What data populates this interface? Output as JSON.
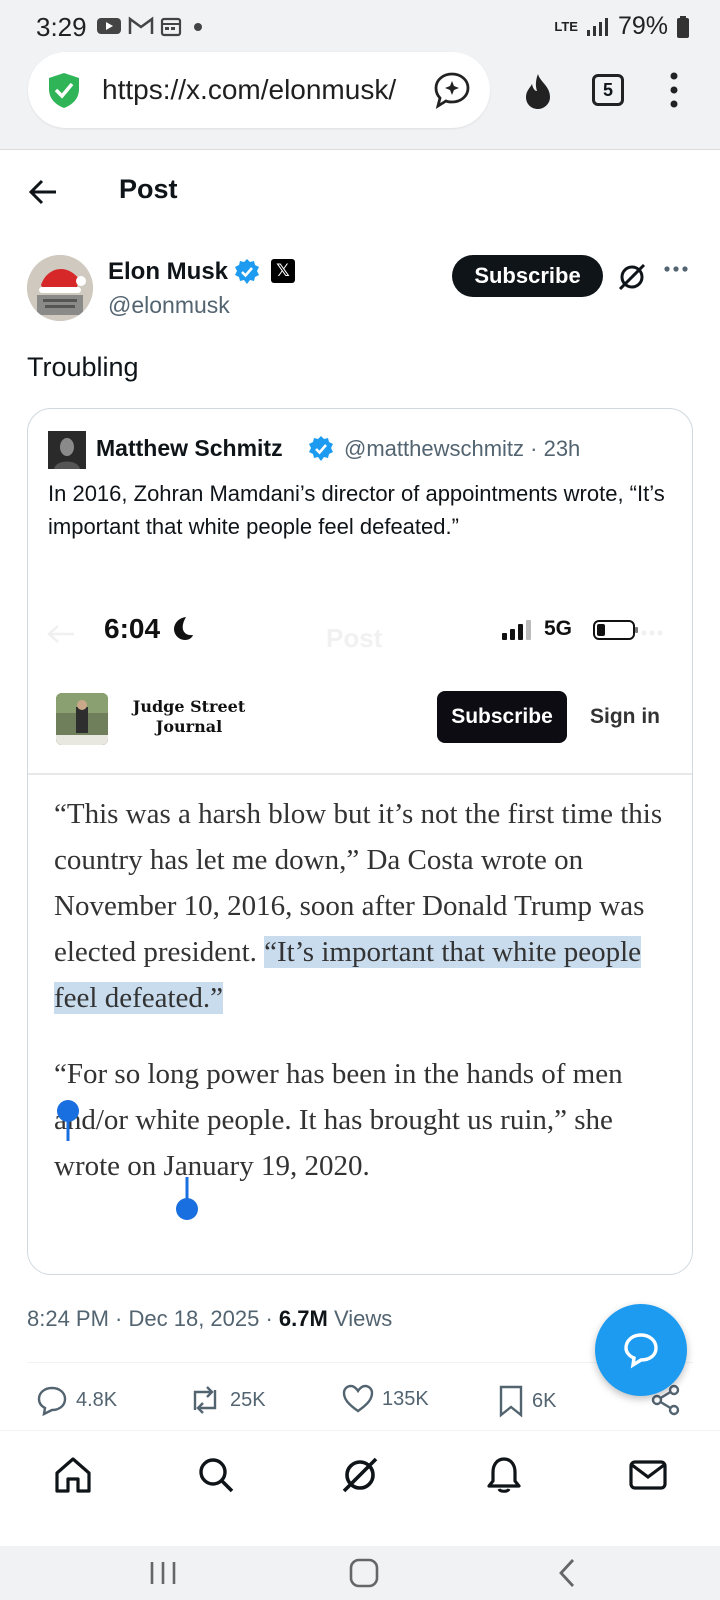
{
  "status_bar": {
    "time": "3:29",
    "network": "LTE",
    "battery": "79%"
  },
  "browser": {
    "url": "https://x.com/elonmusk/",
    "tab_count": "5"
  },
  "header": {
    "title": "Post"
  },
  "author": {
    "name": "Elon Musk",
    "handle": "@elonmusk",
    "x_badge": "𝕏",
    "subscribe_label": "Subscribe"
  },
  "post": {
    "text": "Troubling"
  },
  "quoted": {
    "name": "Matthew Schmitz",
    "handle_time": "@matthewschmitz · 23h",
    "text": "In 2016, Zohran Mamdani’s director of appointments wrote, “It’s important that white people feel defeated.”"
  },
  "screenshot": {
    "time": "6:04",
    "ghost_title": "Post",
    "network": "5G",
    "publication": "Judge Street Journal",
    "subscribe_label": "Subscribe",
    "signin_label": "Sign in",
    "paragraph1_plain": "“This was a harsh blow but it’s not the first time this country has let me down,” Da Costa wrote on November 10, 2016, soon after Donald Trump was elected president. ",
    "paragraph1_highlight": "“It’s important that white people feel defeated.”",
    "paragraph2": "“For so long power has been in the hands of men and/or white people. It has brought us ruin,” she wrote on January 19, 2020."
  },
  "meta": {
    "time_date": "8:24 PM · Dec 18, 2025 · ",
    "views_count": "6.7M",
    "views_label": " Views"
  },
  "actions": {
    "replies": "4.8K",
    "reposts": "25K",
    "likes": "135K",
    "bookmarks": "6K"
  },
  "colors": {
    "accent": "#1d9bf0",
    "text": "#0f1419",
    "muted": "#536471",
    "highlight": "#c9dcee",
    "shield": "#2fb457"
  },
  "icons": {
    "tabs": [
      "home-icon",
      "search-icon",
      "grok-icon",
      "notifications-icon",
      "messages-icon"
    ]
  }
}
